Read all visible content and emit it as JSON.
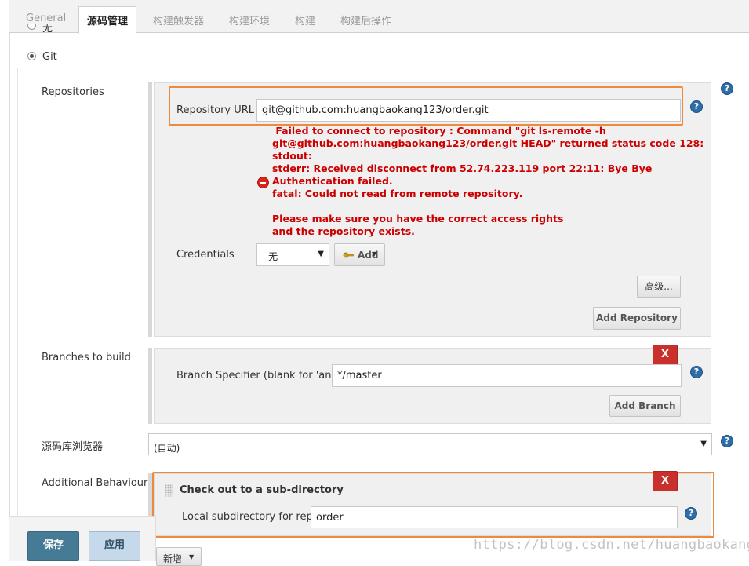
{
  "tabs": [
    "General",
    "源码管理",
    "构建触发器",
    "构建环境",
    "构建",
    "构建后操作"
  ],
  "scm": {
    "none_label": "无",
    "git_label": "Git"
  },
  "repositories": {
    "section_label": "Repositories",
    "url_label": "Repository URL",
    "url_value": "git@github.com:huangbaokang123/order.git",
    "error_lines": [
      " Failed to connect to repository : Command \"git ls-remote -h",
      "git@github.com:huangbaokang123/order.git HEAD\" returned status code 128:",
      "stdout:",
      "stderr: Received disconnect from 52.74.223.119 port 22:11: Bye Bye",
      "Authentication failed.",
      "fatal: Could not read from remote repository.",
      "",
      "Please make sure you have the correct access rights",
      "and the repository exists."
    ],
    "credentials_label": "Credentials",
    "credentials_value": "- 无 -",
    "add_button": "Add",
    "advanced_button": "高级...",
    "add_repository_button": "Add Repository"
  },
  "branches": {
    "section_label": "Branches to build",
    "delete_button": "X",
    "specifier_label": "Branch Specifier (blank for 'any')",
    "specifier_value": "*/master",
    "add_branch_button": "Add Branch"
  },
  "browser": {
    "label": "源码库浏览器",
    "value": "(自动)"
  },
  "behaviours": {
    "section_label": "Additional Behaviours",
    "title": "Check out to a sub-directory",
    "delete_button": "X",
    "local_subdir_label": "Local subdirectory for repo",
    "local_subdir_value": "order",
    "add_new_button": "新增"
  },
  "footer": {
    "save_button": "保存",
    "apply_button": "应用"
  },
  "watermark": "https://blog.csdn.net/huangbaokang",
  "help_glyph": "?",
  "colors": {
    "highlight_orange": "#ef8a3c",
    "error_red": "#cc0000",
    "delete_red": "#c9302c",
    "save_blue": "#457b94",
    "help_blue": "#2e6ea8"
  }
}
